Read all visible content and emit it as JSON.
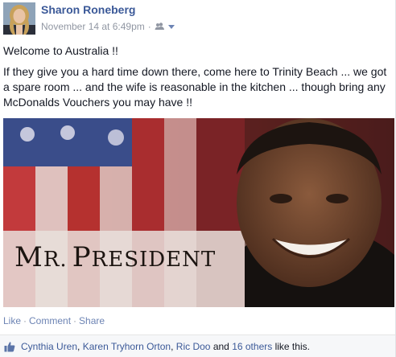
{
  "post": {
    "author": "Sharon Roneberg",
    "timestamp": "November 14 at 6:49pm",
    "separator": "·",
    "audience_icon": "friends-icon",
    "line1": "Welcome to Australia !!",
    "line2": "If they give you a hard time down there, come here to Trinity Beach ... we got a spare room ... and the wife is reasonable in the kitchen ... though bring any McDonalds Vouchers you may have !!",
    "photo_caption_big_1": "M",
    "photo_caption_small_1": "R.",
    "photo_caption_big_2": "P",
    "photo_caption_small_2": "RESIDENT"
  },
  "actions": {
    "like": "Like",
    "comment": "Comment",
    "share": "Share",
    "dot": "·"
  },
  "likes": {
    "people": [
      "Cynthia Uren",
      "Karen Tryhorn Orton",
      "Ric Doo"
    ],
    "comma": ",",
    "and": "and",
    "others": "16 others",
    "suffix": "like this."
  },
  "colors": {
    "link": "#3b5998",
    "meta": "#9197a3",
    "text": "#141823"
  }
}
